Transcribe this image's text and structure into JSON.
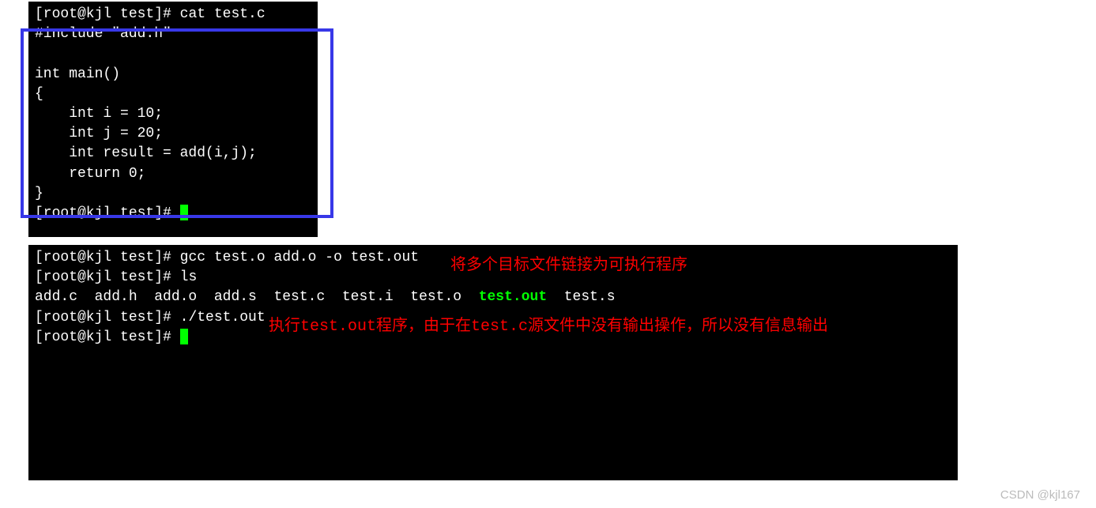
{
  "terminal1": {
    "prompt1": "[root@kjl test]# ",
    "cmd1": "cat test.c",
    "code_line1": "#include \"add.h\"",
    "code_line2": "",
    "code_line3": "int main()",
    "code_line4": "{",
    "code_line5": "    int i = 10;",
    "code_line6": "    int j = 20;",
    "code_line7": "    int result = add(i,j);",
    "code_line8": "    return 0;",
    "code_line9": "}",
    "prompt2": "[root@kjl test]# "
  },
  "terminal2": {
    "prompt1": "[root@kjl test]# ",
    "cmd1": "gcc test.o add.o -o test.out",
    "prompt2": "[root@kjl test]# ",
    "cmd2": "ls",
    "ls_part1": "add.c  add.h  add.o  add.s  test.c  test.i  test.o  ",
    "ls_highlight": "test.out",
    "ls_part2": "  test.s",
    "prompt3": "[root@kjl test]# ",
    "cmd3": "./test.out",
    "prompt4": "[root@kjl test]# "
  },
  "annotations": {
    "anno1": "将多个目标文件链接为可执行程序",
    "anno2": "执行test.out程序，由于在test.c源文件中没有输出操作，所以没有信息输出"
  },
  "watermark": "CSDN @kjl167"
}
